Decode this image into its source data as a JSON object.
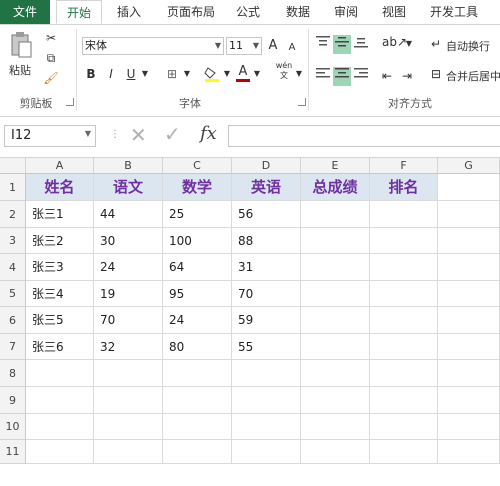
{
  "tabs": [
    "文件",
    "开始",
    "插入",
    "页面布局",
    "公式",
    "数据",
    "审阅",
    "视图",
    "开发工具"
  ],
  "active_tab": "开始",
  "clipboard": {
    "paste_label": "粘贴",
    "group_label": "剪贴板"
  },
  "font": {
    "name": "宋体",
    "size": "11",
    "group_label": "字体",
    "bold": "B",
    "italic": "I",
    "underline": "U",
    "grow": "A",
    "shrink": "A",
    "font_color": "A",
    "phonetic": "wén"
  },
  "align": {
    "group_label": "对齐方式",
    "wrap_label": "自动换行",
    "merge_label": "合并后居中"
  },
  "formula_bar": {
    "name_box": "I12",
    "fx": "fx",
    "value": ""
  },
  "columns": [
    "A",
    "B",
    "C",
    "D",
    "E",
    "F",
    "G"
  ],
  "rows": [
    "1",
    "2",
    "3",
    "4",
    "5",
    "6",
    "7",
    "8",
    "9",
    "10",
    "11"
  ],
  "table": {
    "headers": [
      "姓名",
      "语文",
      "数学",
      "英语",
      "总成绩",
      "排名"
    ],
    "data": [
      [
        "张三1",
        "44",
        "25",
        "56",
        "",
        ""
      ],
      [
        "张三2",
        "30",
        "100",
        "88",
        "",
        ""
      ],
      [
        "张三3",
        "24",
        "64",
        "31",
        "",
        ""
      ],
      [
        "张三4",
        "19",
        "95",
        "70",
        "",
        ""
      ],
      [
        "张三5",
        "70",
        "24",
        "59",
        "",
        ""
      ],
      [
        "张三6",
        "32",
        "80",
        "55",
        "",
        ""
      ]
    ]
  },
  "colors": {
    "excel_green": "#217346",
    "header_fill": "#dce6f1",
    "header_text": "#7030a0",
    "highlight": "#9fd5b7"
  }
}
